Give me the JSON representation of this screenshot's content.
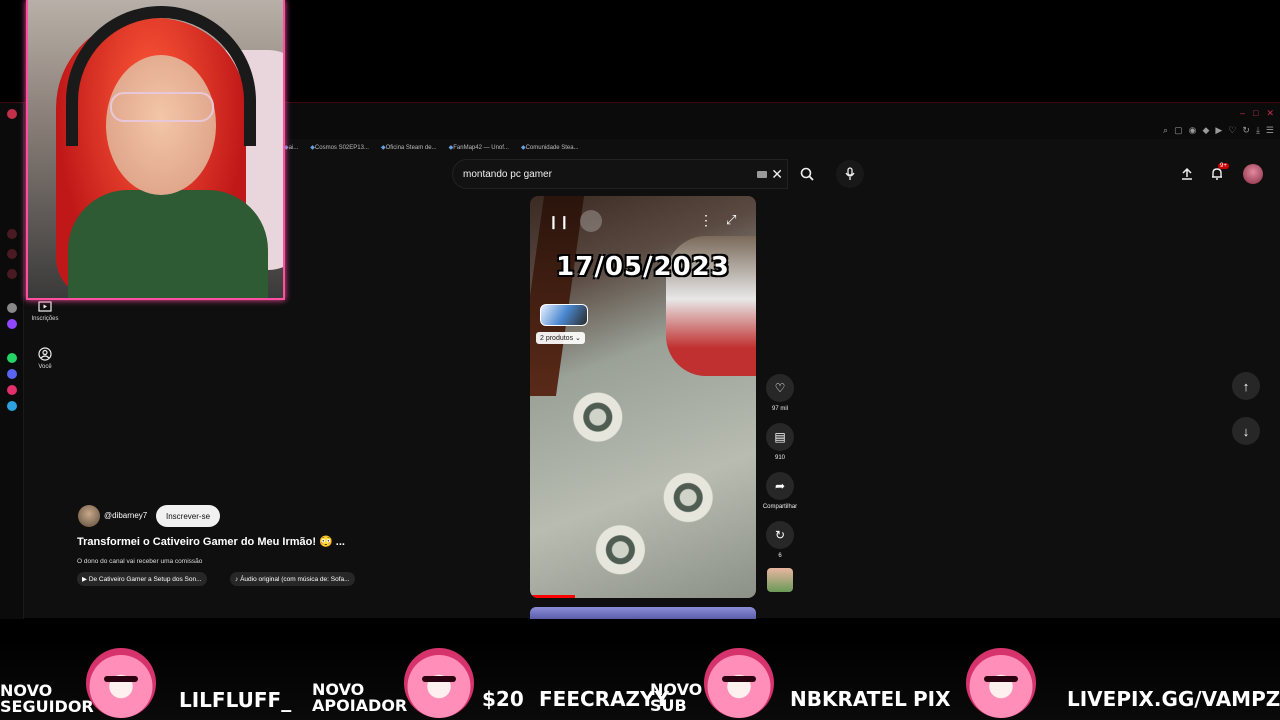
{
  "browser": {
    "bookmarks": [
      "ai...",
      "Cosmos S02EP13...",
      "Oficina Steam de...",
      "FanMap42 — Unof...",
      "Comunidade Stea..."
    ],
    "window_controls": [
      "–",
      "□",
      "✕"
    ]
  },
  "search": {
    "query": "montando pc gamer"
  },
  "header": {
    "notifications_badge": "9+"
  },
  "sidebar": {
    "items": [
      {
        "label": "Inscrições",
        "icon": "subscriptions-icon"
      },
      {
        "label": "Você",
        "icon": "you-icon"
      }
    ]
  },
  "short": {
    "date_overlay": "17/05/2023",
    "products_label": "2 produtos",
    "channel_handle": "@dibarney7",
    "subscribe_label": "Inscrever-se",
    "title": "Transformei o Cativeiro Gamer do Meu Irmão! 😳 ...",
    "commission_note": "O dono do canal vai receber uma comissão",
    "chip_related": "De Cativeiro Gamer a Setup dos Son...",
    "chip_audio": "Áudio original (com música de: Sofa...",
    "likes": "97 mil",
    "comments": "910",
    "share_label": "Compartilhar",
    "remix_count": "6"
  },
  "alerts": {
    "items": [
      {
        "line1": "NOVO",
        "line2": "SEGUIDOR"
      },
      {
        "line1": "LILFLUFF_"
      },
      {
        "line1": "NOVO",
        "line2": "APOIADOR"
      },
      {
        "line1": "$20"
      },
      {
        "line1": "FEECRAZYY"
      },
      {
        "line1": "NOVO",
        "line2": "SUB"
      },
      {
        "line1": "NBKRATEL"
      },
      {
        "line1": "PIX"
      },
      {
        "line1": "LIVEPIX.GG/VAMPZINI"
      }
    ]
  },
  "colors": {
    "accent": "#ff4fa0",
    "youtube_red": "#ff0000",
    "background": "#0f0f0f"
  }
}
